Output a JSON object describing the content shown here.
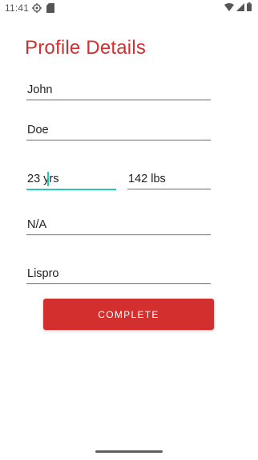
{
  "status_bar": {
    "time": "11:41",
    "left_icons": [
      "settings-icon",
      "sd-card-icon"
    ],
    "right_icons": [
      "wifi-icon",
      "cell-signal-icon",
      "battery-icon"
    ]
  },
  "page": {
    "title": "Profile Details",
    "title_color": "#d32f2f",
    "accent_color": "#26c6b9"
  },
  "fields": {
    "first_name": "John",
    "last_name": "Doe",
    "age": "23 yrs",
    "weight": "142 lbs",
    "field_4": "N/A",
    "insulin": "Lispro"
  },
  "button": {
    "complete_label": "COMPLETE",
    "color": "#d32f2f"
  }
}
